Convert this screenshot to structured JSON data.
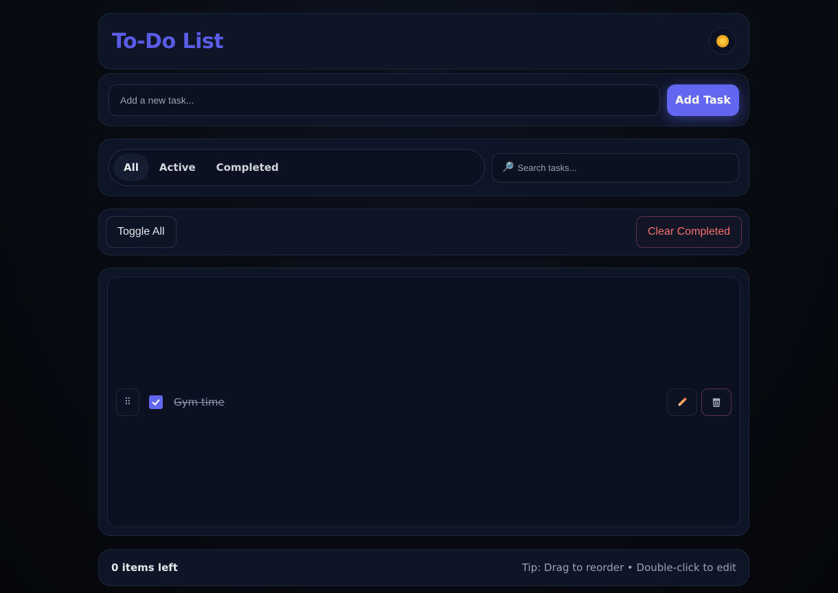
{
  "header": {
    "title": "To-Do List",
    "theme_icon": "sun-icon"
  },
  "add": {
    "placeholder": "Add a new task...",
    "button_label": "Add Task"
  },
  "filters": {
    "tabs": [
      {
        "label": "All",
        "active": true
      },
      {
        "label": "Active",
        "active": false
      },
      {
        "label": "Completed",
        "active": false
      }
    ],
    "search_placeholder": "Search tasks..."
  },
  "actions": {
    "toggle_all_label": "Toggle All",
    "clear_completed_label": "Clear Completed"
  },
  "tasks": [
    {
      "text": "Gym time",
      "completed": true
    }
  ],
  "footer": {
    "items_left": "0 items left",
    "tip": "Tip: Drag to reorder • Double-click to edit"
  },
  "colors": {
    "accent": "#6366f1",
    "danger": "#f87171",
    "background": "#080b12"
  }
}
